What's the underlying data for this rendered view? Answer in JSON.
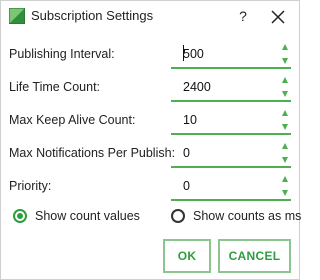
{
  "window": {
    "title": "Subscription Settings",
    "help_label": "?",
    "icon": "app-icon",
    "close_icon": "close-icon"
  },
  "fields": [
    {
      "label": "Publishing Interval:",
      "value": "500"
    },
    {
      "label": "Life Time Count:",
      "value": "2400"
    },
    {
      "label": "Max Keep Alive Count:",
      "value": "10"
    },
    {
      "label": "Max Notifications Per Publish:",
      "value": "0"
    },
    {
      "label": "Priority:",
      "value": "0"
    }
  ],
  "radios": [
    {
      "label": "Show count values",
      "selected": true
    },
    {
      "label": "Show counts as ms",
      "selected": false
    }
  ],
  "buttons": {
    "ok_label": "OK",
    "cancel_label": "CANCEL"
  },
  "colors": {
    "accent": "#4caf50",
    "accent_text": "#2e9e3c",
    "button_border": "#8bc58f"
  }
}
